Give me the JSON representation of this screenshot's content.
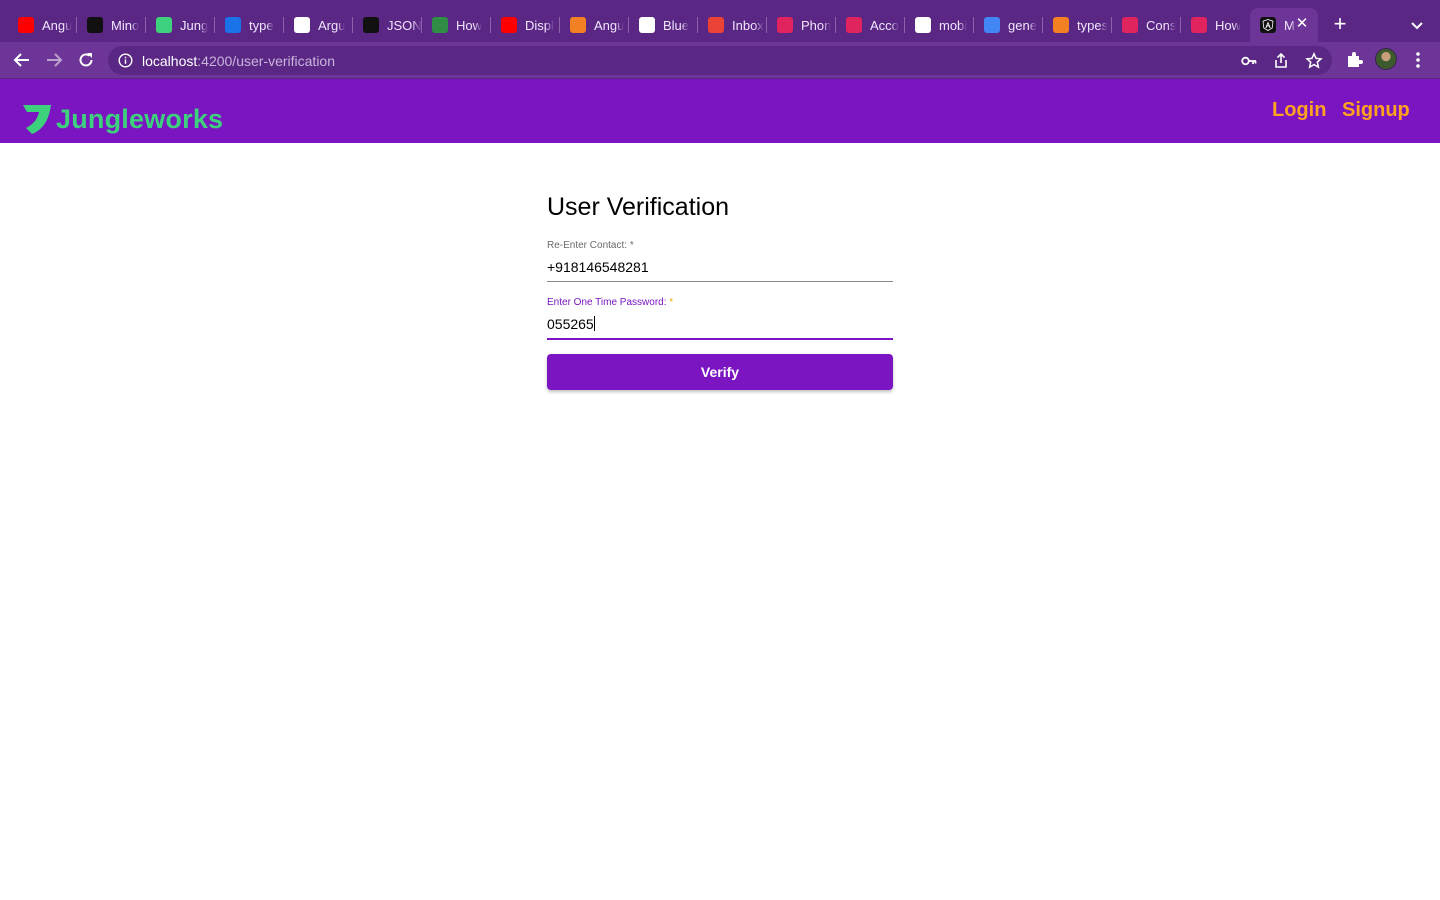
{
  "browser": {
    "tabs": [
      {
        "title": "Angu",
        "icon": "youtube-icon",
        "color": "#ff0000"
      },
      {
        "title": "Mino",
        "icon": "angular-icon",
        "color": "#111111"
      },
      {
        "title": "Jung",
        "icon": "jungleworks-icon",
        "color": "#3dd17e"
      },
      {
        "title": "type",
        "icon": "e-icon",
        "color": "#1a73e8"
      },
      {
        "title": "Argu",
        "icon": "github-icon",
        "color": "#ffffff"
      },
      {
        "title": "JSON",
        "icon": "json-icon",
        "color": "#111111"
      },
      {
        "title": "How",
        "icon": "geeksforgeeks-icon",
        "color": "#2f8d46"
      },
      {
        "title": "Displ",
        "icon": "youtube-icon",
        "color": "#ff0000"
      },
      {
        "title": "Angu",
        "icon": "stackoverflow-icon",
        "color": "#f48024"
      },
      {
        "title": "Blue",
        "icon": "globe-icon",
        "color": "#ffffff"
      },
      {
        "title": "Inbox",
        "icon": "gmail-icon",
        "color": "#ea4335"
      },
      {
        "title": "Phon",
        "icon": "jungleworks-red-icon",
        "color": "#e0245e"
      },
      {
        "title": "Acco",
        "icon": "jungleworks-red-icon",
        "color": "#e0245e"
      },
      {
        "title": "mobi",
        "icon": "github-icon",
        "color": "#ffffff"
      },
      {
        "title": "gene",
        "icon": "google-icon",
        "color": "#4285f4"
      },
      {
        "title": "types",
        "icon": "stackoverflow-icon",
        "color": "#f48024"
      },
      {
        "title": "Cons",
        "icon": "jungleworks-red-icon",
        "color": "#e0245e"
      },
      {
        "title": "How",
        "icon": "jungleworks-red-icon",
        "color": "#e0245e"
      }
    ],
    "active_tab": {
      "title": "M",
      "icon": "angular-icon"
    },
    "url_host": "localhost",
    "url_path": ":4200/user-verification"
  },
  "header": {
    "brand": "Jungleworks",
    "login_label": "Login",
    "signup_label": "Signup"
  },
  "form": {
    "title": "User Verification",
    "contact_label": "Re-Enter Contact:",
    "contact_required": "*",
    "contact_value": "+918146548281",
    "otp_label": "Enter One Time Password:",
    "otp_required": "*",
    "otp_value": "055265",
    "verify_label": "Verify"
  },
  "colors": {
    "primary": "#7a15c1",
    "accent": "#ffa21f",
    "brand_green": "#3dd17e",
    "required_focus": "#f0b400"
  }
}
